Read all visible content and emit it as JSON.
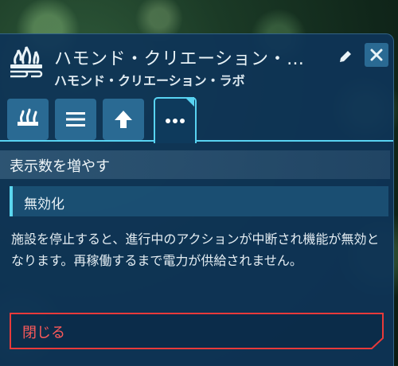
{
  "header": {
    "title": "ハモンド・クリエーション・…",
    "subtitle": "ハモンド・クリエーション・ラボ",
    "building_icon": "building-icon",
    "edit_icon": "pencil-icon",
    "close_icon": "close-icon"
  },
  "tabs": [
    {
      "name": "building-tab",
      "icon": "building-icon"
    },
    {
      "name": "list-tab",
      "icon": "list-icon"
    },
    {
      "name": "upgrade-tab",
      "icon": "arrow-up-icon"
    },
    {
      "name": "more-tab",
      "icon": "more-dots-icon",
      "active": true
    }
  ],
  "section": {
    "show_more_label": "表示数を増やす"
  },
  "disable": {
    "label": "無効化",
    "description": "施設を停止すると、進行中のアクションが中断され機能が無効となります。再稼働するまで電力が供給されません。"
  },
  "close_action": {
    "label": "閉じる"
  },
  "colors": {
    "panel": "#0e3458",
    "accent": "#58d3f2",
    "tab_bg": "#2a6a93",
    "danger": "#e83a3a"
  }
}
